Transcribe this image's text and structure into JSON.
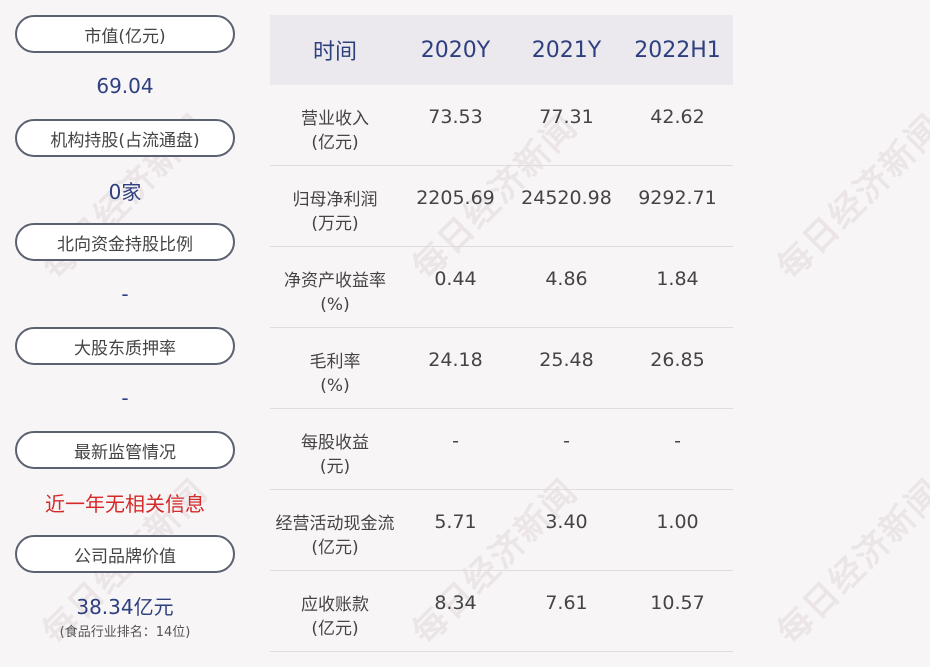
{
  "left_panel": [
    {
      "label": "市值(亿元)",
      "value": "69.04",
      "style": "blue"
    },
    {
      "label": "机构持股(占流通盘)",
      "value": "0家",
      "style": "blue"
    },
    {
      "label": "北向资金持股比例",
      "value": "-",
      "style": "blue"
    },
    {
      "label": "大股东质押率",
      "value": "-",
      "style": "blue"
    },
    {
      "label": "最新监管情况",
      "value": "近一年无相关信息",
      "style": "red"
    },
    {
      "label": "公司品牌价值",
      "value": "38.34亿元",
      "sub": "(食品行业排名：14位)",
      "style": "brand"
    }
  ],
  "table": {
    "headers": [
      "时间",
      "2020Y",
      "2021Y",
      "2022H1"
    ],
    "rows": [
      {
        "label": [
          "营业收入",
          "(亿元)"
        ],
        "values": [
          "73.53",
          "77.31",
          "42.62"
        ]
      },
      {
        "label": [
          "归母净利润",
          "(万元)"
        ],
        "values": [
          "2205.69",
          "24520.98",
          "9292.71"
        ]
      },
      {
        "label": [
          "净资产收益率",
          "(%)"
        ],
        "values": [
          "0.44",
          "4.86",
          "1.84"
        ]
      },
      {
        "label": [
          "毛利率",
          "(%)"
        ],
        "values": [
          "24.18",
          "25.48",
          "26.85"
        ]
      },
      {
        "label": [
          "每股收益",
          "(元)"
        ],
        "values": [
          "-",
          "-",
          "-"
        ]
      },
      {
        "label": [
          "经营活动现金流",
          "(亿元)"
        ],
        "values": [
          "5.71",
          "3.40",
          "1.00"
        ]
      },
      {
        "label": [
          "应收账款",
          "(亿元)"
        ],
        "values": [
          "8.34",
          "7.61",
          "10.57"
        ]
      }
    ]
  },
  "watermark": "每日经济新闻",
  "colors": {
    "value_blue": "#2d3f7f",
    "alert_red": "#d42a2a",
    "header_bg": "#ebe9ed",
    "pill_border": "#5b6170"
  }
}
